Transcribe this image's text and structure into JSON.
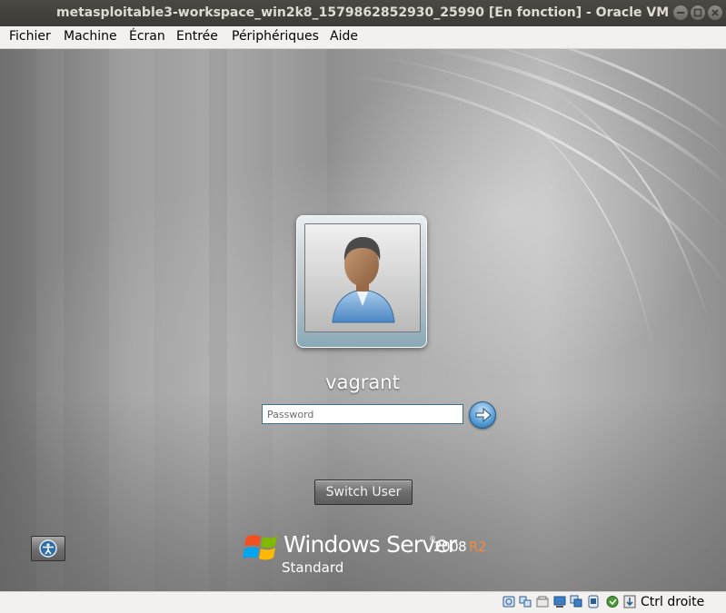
{
  "window": {
    "title": "metasploitable3-workspace_win2k8_1579862852930_25990 [En fonction] - Oracle VM VirtualBox"
  },
  "menu": {
    "items": [
      "Fichier",
      "Machine",
      "Écran",
      "Entrée",
      "Périphériques",
      "Aide"
    ]
  },
  "login": {
    "username": "vagrant",
    "password_placeholder": "Password",
    "password_value": "",
    "switch_user_label": "Switch User"
  },
  "branding": {
    "product": "Windows Server",
    "registered": "®",
    "version": "2008",
    "release": "R2",
    "edition": "Standard",
    "release_color": "#f08a3c"
  },
  "statusbar": {
    "icons": [
      "hard-disk-icon",
      "optical-drive-icon",
      "audio-icon",
      "network-icon",
      "usb-icon",
      "shared-folders-icon",
      "display-icon",
      "video-capture-icon",
      "cpu-icon",
      "mouse-integration-icon"
    ],
    "host_key": "Ctrl droite"
  }
}
